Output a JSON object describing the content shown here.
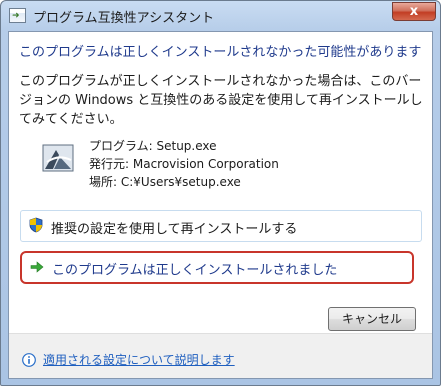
{
  "window": {
    "title": "プログラム互換性アシスタント",
    "close_label": "x"
  },
  "dialog": {
    "heading": "このプログラムは正しくインストールされなかった可能性があります",
    "message": "このプログラムが正しくインストールされなかった場合は、このバージョンの Windows と互換性のある設定を使用して再インストールしてみてください。",
    "details": {
      "program": "プログラム: Setup.exe",
      "publisher": "発行元: Macrovision Corporation",
      "location": "場所: C:¥Users¥setup.exe"
    },
    "options": {
      "reinstall_label": "推奨の設定を使用して再インストールする",
      "installed_ok_label": "このプログラムは正しくインストールされました"
    },
    "cancel_label": "キャンセル",
    "help_link": "適用される設定について説明します"
  }
}
